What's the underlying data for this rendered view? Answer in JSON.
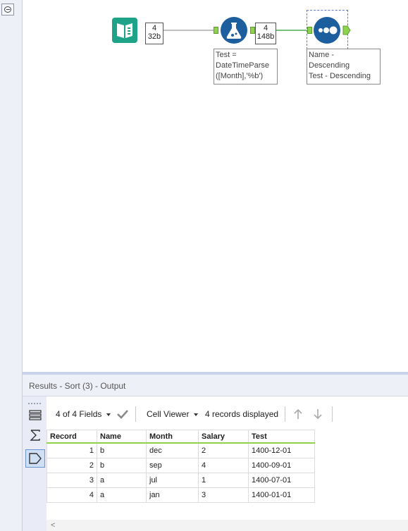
{
  "workflow": {
    "input_tool": {
      "records": "4",
      "size": "32b"
    },
    "formula_tool": {
      "records": "4",
      "size": "148b",
      "annotation": [
        "Test =",
        "DateTimeParse",
        "([Month],'%b')"
      ]
    },
    "sort_tool": {
      "annotation": [
        "Name -",
        "Descending",
        "Test - Descending"
      ]
    }
  },
  "results": {
    "title": "Results - Sort (3) - Output",
    "toolbar": {
      "fields_label": "4 of 4 Fields",
      "cell_viewer_label": "Cell Viewer",
      "records_label": "4 records displayed"
    },
    "columns": [
      "Record",
      "Name",
      "Month",
      "Salary",
      "Test"
    ],
    "rows": [
      {
        "record": "1",
        "name": "b",
        "month": "dec",
        "salary": "2",
        "test": "1400-12-01"
      },
      {
        "record": "2",
        "name": "b",
        "month": "sep",
        "salary": "4",
        "test": "1400-09-01"
      },
      {
        "record": "3",
        "name": "a",
        "month": "jul",
        "salary": "1",
        "test": "1400-07-01"
      },
      {
        "record": "4",
        "name": "a",
        "month": "jan",
        "salary": "3",
        "test": "1400-01-01"
      }
    ]
  },
  "colors": {
    "input_tool": "#1fa388",
    "formula_tool": "#1d5f9e",
    "sort_tool": "#1d5f9e",
    "connection": "#4caf50",
    "anchor": "#8fd14f"
  },
  "icons": {
    "input_tool": "book-icon",
    "formula_tool": "flask-icon",
    "sort_tool": "sort-dots-icon"
  }
}
